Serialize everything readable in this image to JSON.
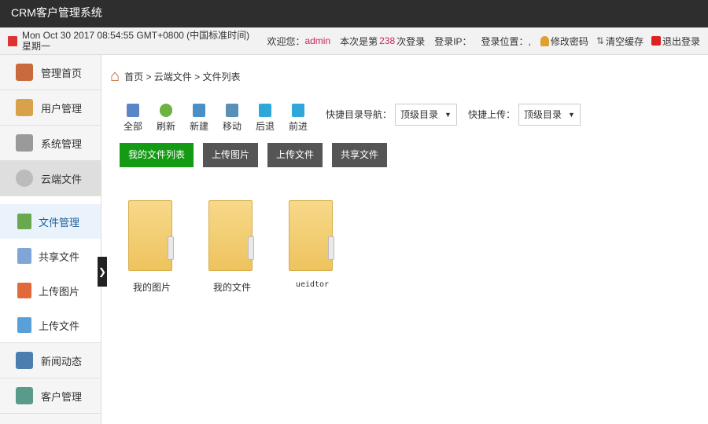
{
  "app": {
    "title": "CRM客户管理系统"
  },
  "infobar": {
    "datetime": "Mon Oct 30 2017 08:54:55 GMT+0800 (中国标准时间) 星期一",
    "welcome_label": "欢迎您：",
    "username": "admin",
    "login_count_prefix": "本次是第",
    "login_count": "238",
    "login_count_suffix": "次登录",
    "login_ip": "登录IP：",
    "login_location": "登录位置：,",
    "change_password": "修改密码",
    "clear_cache": "清空缓存",
    "logout": "退出登录"
  },
  "sidebar": {
    "items": [
      {
        "label": "管理首页"
      },
      {
        "label": "用户管理"
      },
      {
        "label": "系统管理"
      },
      {
        "label": "云端文件"
      }
    ],
    "sub": [
      {
        "label": "文件管理"
      },
      {
        "label": "共享文件"
      },
      {
        "label": "上传图片"
      },
      {
        "label": "上传文件"
      }
    ],
    "bottom": [
      {
        "label": "新闻动态"
      },
      {
        "label": "客户管理"
      }
    ]
  },
  "breadcrumb": [
    "首页",
    "云端文件",
    "文件列表"
  ],
  "toolbar": {
    "items": [
      {
        "label": "全部",
        "color": "#5b86c5"
      },
      {
        "label": "刷新",
        "color": "#6cb33f"
      },
      {
        "label": "新建",
        "color": "#4a90c8"
      },
      {
        "label": "移动",
        "color": "#5a8fb8"
      },
      {
        "label": "后退",
        "color": "#2fa7d8"
      },
      {
        "label": "前进",
        "color": "#2fa7d8"
      }
    ],
    "quick_nav_label": "快捷目录导航：",
    "quick_nav_value": "顶级目录",
    "quick_upload_label": "快捷上传：",
    "quick_upload_value": "顶级目录"
  },
  "buttons": {
    "my_files": "我的文件列表",
    "upload_image": "上传图片",
    "upload_file": "上传文件",
    "shared": "共享文件"
  },
  "folders": [
    {
      "name": "我的图片"
    },
    {
      "name": "我的文件"
    },
    {
      "name": "ueidtor"
    }
  ]
}
